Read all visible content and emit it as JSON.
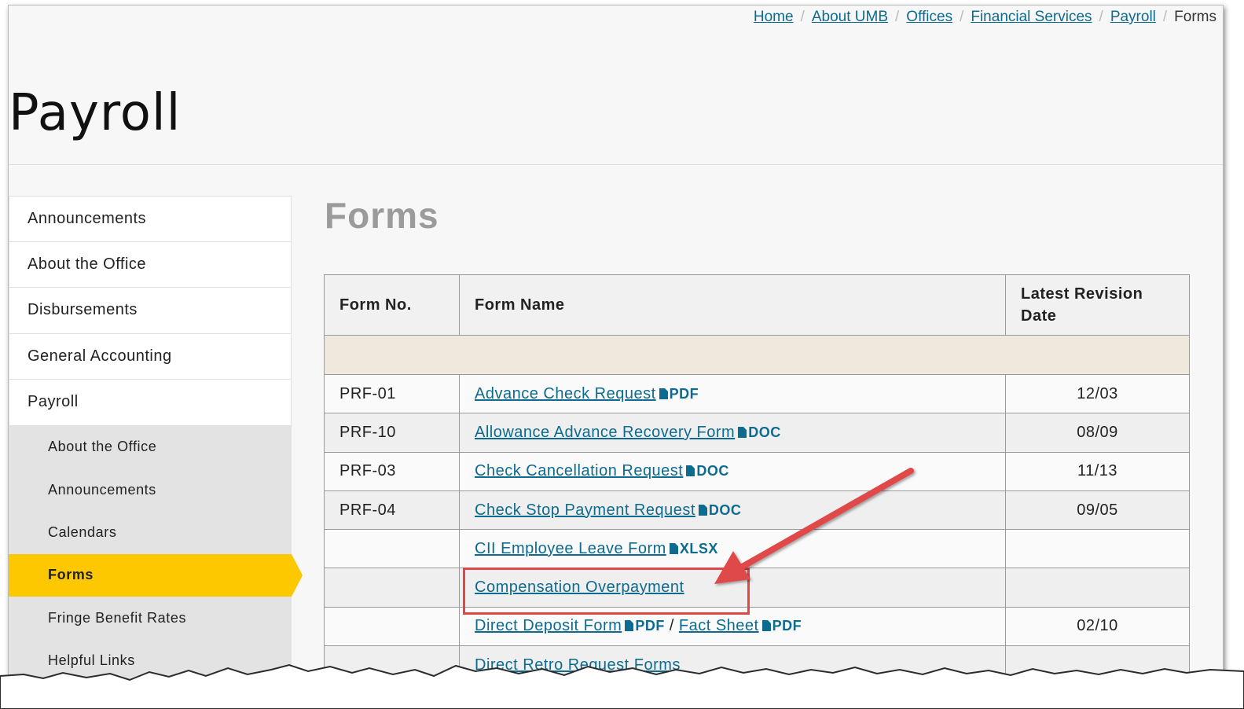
{
  "breadcrumb": {
    "items": [
      "Home",
      "About UMB",
      "Offices",
      "Financial Services",
      "Payroll"
    ],
    "current": "Forms",
    "separator": "/"
  },
  "page_title": "Payroll",
  "sidebar": {
    "items": [
      "Announcements",
      "About the Office",
      "Disbursements",
      "General Accounting",
      "Payroll"
    ],
    "sub_items": [
      "About the Office",
      "Announcements",
      "Calendars",
      "Forms",
      "Fringe Benefit Rates",
      "Helpful Links"
    ],
    "active": "Forms"
  },
  "section_heading": "Forms",
  "table": {
    "headers": {
      "form_no": "Form No.",
      "form_name": "Form Name",
      "revision_line1": "Latest Revision",
      "revision_line2": "Date"
    },
    "rows": [
      {
        "no": "PRF-01",
        "name": "Advance Check Request",
        "type": "PDF",
        "date": "12/03"
      },
      {
        "no": "PRF-10",
        "name": "Allowance Advance Recovery Form",
        "type": "DOC",
        "date": "08/09"
      },
      {
        "no": "PRF-03",
        "name": "Check Cancellation Request",
        "type": "DOC",
        "date": "11/13"
      },
      {
        "no": "PRF-04",
        "name": "Check Stop Payment Request",
        "type": "DOC",
        "date": "09/05"
      },
      {
        "no": "",
        "name": "CII Employee Leave Form",
        "type": "XLSX",
        "date": ""
      },
      {
        "no": "",
        "name": "Compensation Overpayment",
        "type": "",
        "date": ""
      },
      {
        "no": "",
        "name": "Direct Deposit Form",
        "type": "PDF",
        "name2": "Fact Sheet",
        "type2": "PDF",
        "date": "02/10"
      },
      {
        "no": "",
        "name": "Direct Retro Request Forms",
        "type": "",
        "date": ""
      }
    ]
  },
  "colors": {
    "link": "#0d6b8f",
    "active_nav": "#fdc800",
    "annotation": "#e04848",
    "band": "#efe9dd"
  }
}
